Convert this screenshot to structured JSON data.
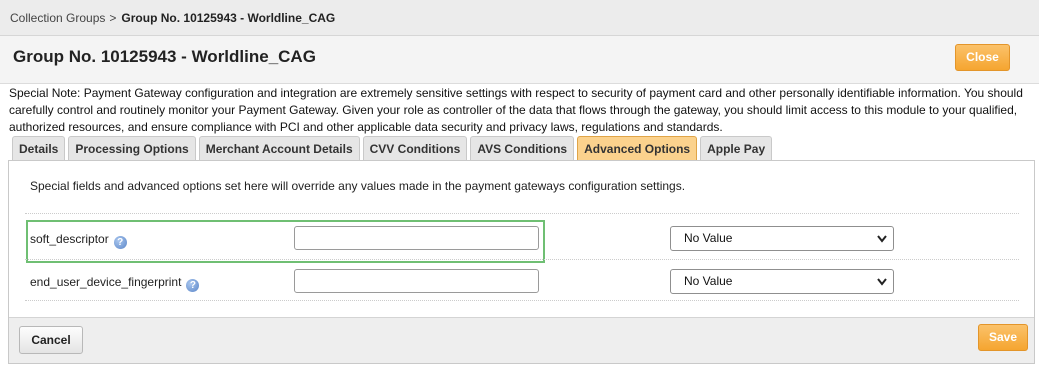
{
  "breadcrumb": {
    "parent": "Collection Groups",
    "separator": ">",
    "current": "Group No. 10125943 - Worldline_CAG"
  },
  "header": {
    "title": "Group No. 10125943 - Worldline_CAG",
    "close_label": "Close"
  },
  "special_note": "Special Note: Payment Gateway configuration and integration are extremely sensitive settings with respect to security of payment card and other personally identifiable information. You should carefully control and routinely monitor your Payment Gateway. Given your role as controller of the data that flows through the gateway, you should limit access to this module to your qualified, authorized resources, and ensure compliance with PCI and other applicable data security and privacy laws, regulations and standards.",
  "tabs": [
    {
      "label": "Details"
    },
    {
      "label": "Processing Options"
    },
    {
      "label": "Merchant Account Details"
    },
    {
      "label": "CVV Conditions"
    },
    {
      "label": "AVS Conditions"
    },
    {
      "label": "Advanced Options",
      "active": true
    },
    {
      "label": "Apple Pay"
    }
  ],
  "panel": {
    "description": "Special fields and advanced options set here will override any values made in the payment gateways configuration settings.",
    "fields": [
      {
        "label": "soft_descriptor",
        "value": "",
        "selected": "No Value",
        "highlighted": true
      },
      {
        "label": "end_user_device_fingerprint",
        "value": "",
        "selected": "No Value",
        "highlighted": false
      }
    ],
    "help_glyph": "?"
  },
  "footer": {
    "cancel_label": "Cancel",
    "save_label": "Save"
  },
  "colors": {
    "accent_orange": "#f5a530",
    "active_tab": "#fbd28d",
    "highlight_green": "#6fbf73",
    "help_blue": "#5b86c8"
  },
  "icons": {
    "help": "help-icon",
    "dropdown": "chevron-down-icon"
  }
}
